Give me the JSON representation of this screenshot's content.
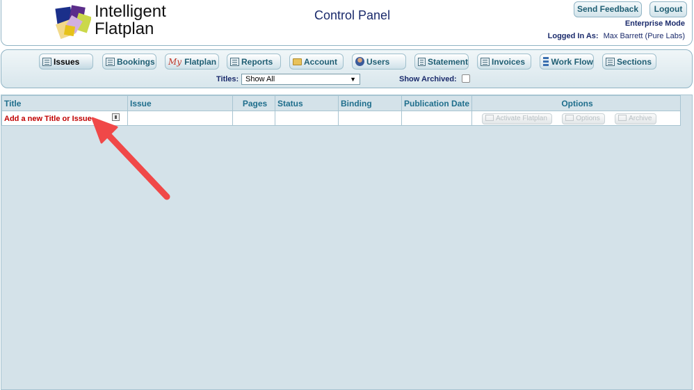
{
  "header": {
    "logo_line1": "Intelligent",
    "logo_line2": "Flatplan",
    "page_title": "Control Panel",
    "feedback_label": "Send Feedback",
    "logout_label": "Logout",
    "mode": "Enterprise Mode",
    "logged_in_label": "Logged In As:",
    "logged_in_user": "Max Barrett (Pure Labs)"
  },
  "nav": {
    "issues": "Issues",
    "bookings": "Bookings",
    "my_prefix": "My",
    "flatplan": "Flatplan",
    "reports": "Reports",
    "account": "Account",
    "users": "Users",
    "statement": "Statement",
    "invoices": "Invoices",
    "workflow": "Work Flow",
    "sections": "Sections"
  },
  "filters": {
    "titles_label": "Titles:",
    "titles_value": "Show All",
    "archived_label": "Show Archived:",
    "archived_checked": false
  },
  "table": {
    "columns": [
      "Title",
      "Issue",
      "Pages",
      "Status",
      "Binding",
      "Publication Date",
      "Options"
    ],
    "add_row_label": "Add a new Title or Issue",
    "options": {
      "activate": "Activate Flatplan",
      "options": "Options",
      "archive": "Archive"
    }
  },
  "colors": {
    "accent": "#1f5e73",
    "add_link": "#c00000",
    "annotation_arrow": "#f04848",
    "panel_bg": "#d4e2e9"
  }
}
